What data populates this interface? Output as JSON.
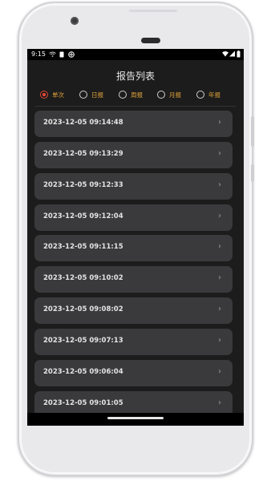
{
  "status_bar": {
    "time": "9:15",
    "left_icons": [
      "wifi-calling-icon",
      "sim-icon",
      "vpn-icon"
    ],
    "right_icons": [
      "wifi-icon",
      "signal-icon",
      "battery-icon"
    ]
  },
  "page": {
    "title": "报告列表"
  },
  "filters": {
    "options": [
      {
        "label": "单次",
        "selected": true
      },
      {
        "label": "日报",
        "selected": false
      },
      {
        "label": "周报",
        "selected": false
      },
      {
        "label": "月报",
        "selected": false
      },
      {
        "label": "年报",
        "selected": false
      }
    ]
  },
  "reports": {
    "items": [
      {
        "timestamp": "2023-12-05 09:14:48"
      },
      {
        "timestamp": "2023-12-05 09:13:29"
      },
      {
        "timestamp": "2023-12-05 09:12:33"
      },
      {
        "timestamp": "2023-12-05 09:12:04"
      },
      {
        "timestamp": "2023-12-05 09:11:15"
      },
      {
        "timestamp": "2023-12-05 09:10:02"
      },
      {
        "timestamp": "2023-12-05 09:08:02"
      },
      {
        "timestamp": "2023-12-05 09:07:13"
      },
      {
        "timestamp": "2023-12-05 09:06:04"
      },
      {
        "timestamp": "2023-12-05 09:01:05"
      }
    ],
    "chevron": "›"
  },
  "colors": {
    "screen_bg": "#1c1c1c",
    "item_bg": "#3a3a3c",
    "radio_selected": "#e24a35",
    "radio_label": "#e1a33a"
  }
}
